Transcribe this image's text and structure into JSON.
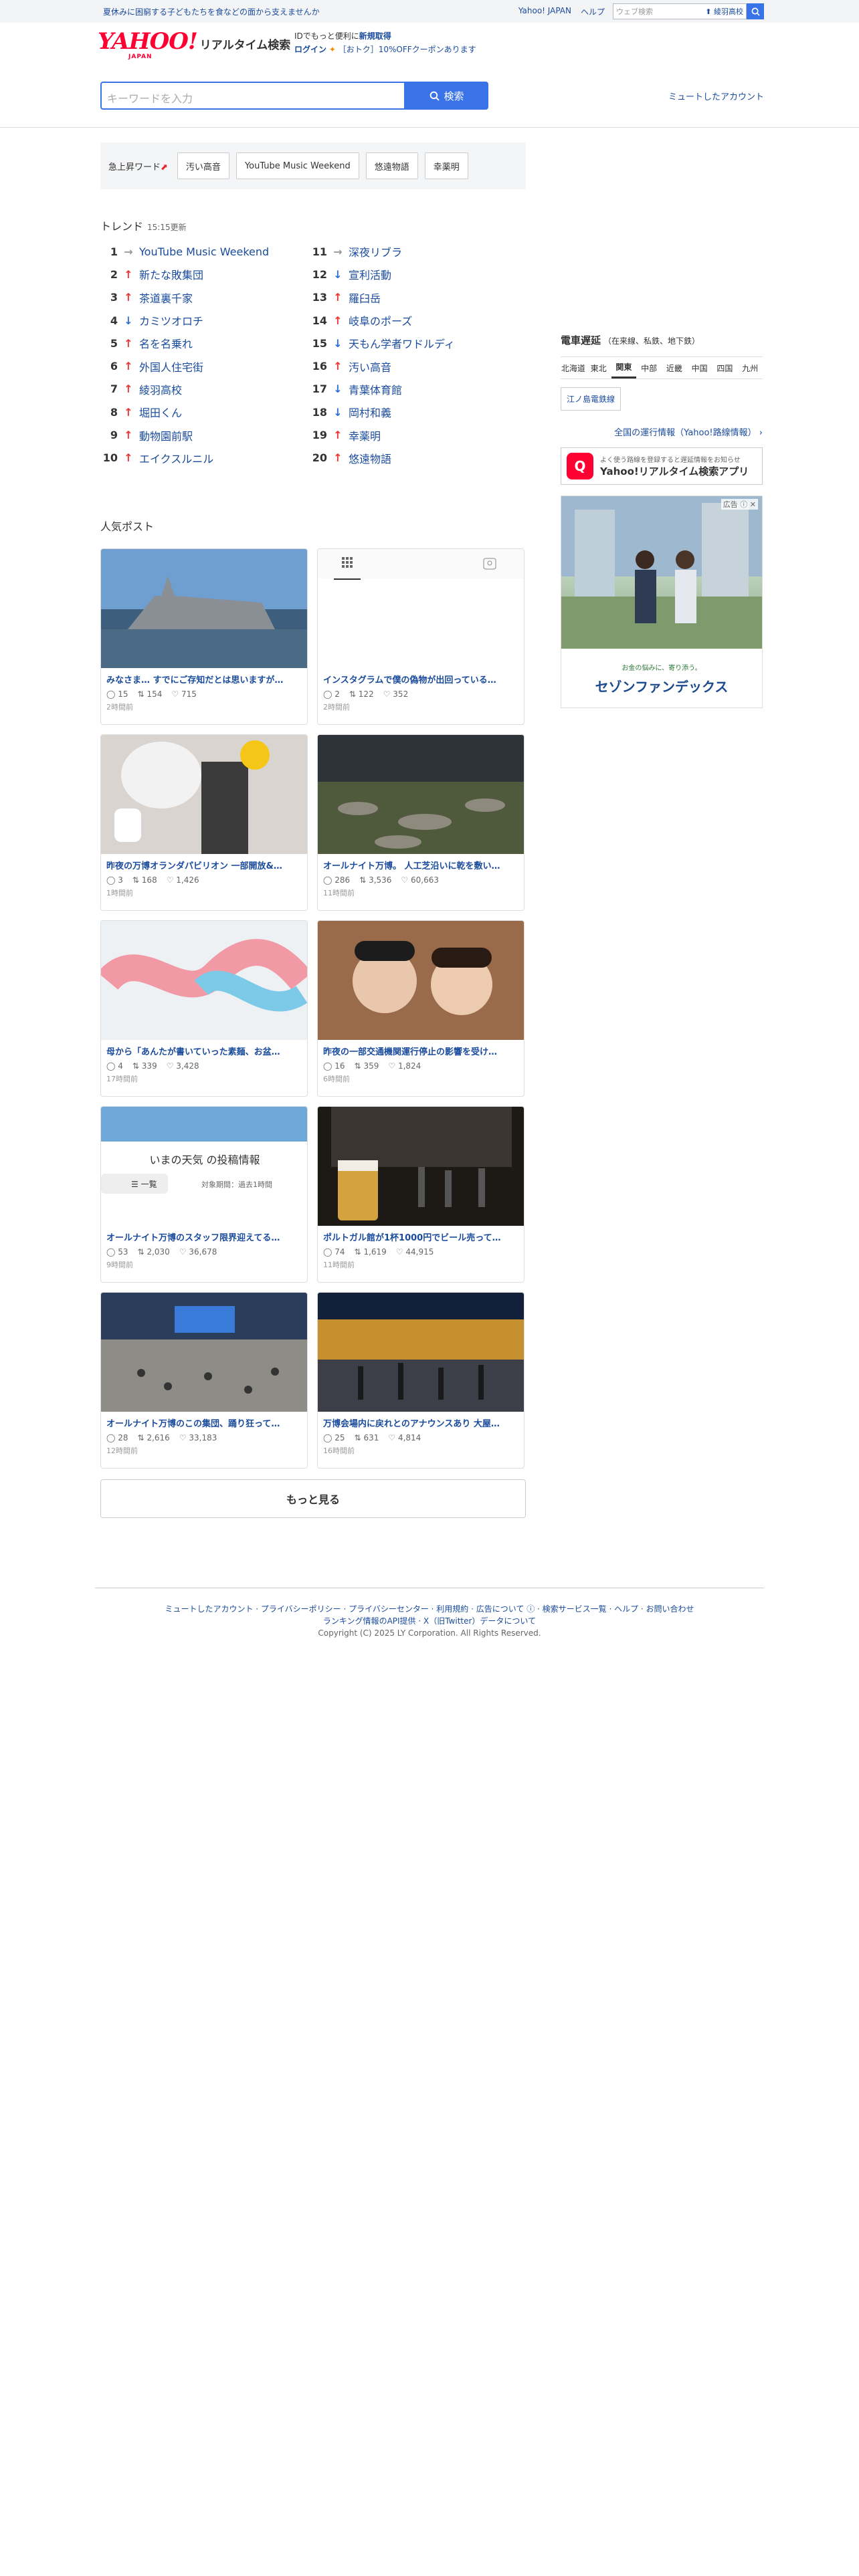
{
  "topbar": {
    "promo": "夏休みに困窮する子どもたちを食などの面から支えませんか",
    "links": [
      "Yahoo! JAPAN",
      "ヘルプ"
    ],
    "mini_search_placeholder": "ウェブ検索",
    "mini_search_trend": "綾羽高校"
  },
  "header": {
    "logo": "YAHOO!",
    "logo_sub": "JAPAN",
    "service_name": "リアルタイム検索",
    "login_line1_pre": "IDでもっと便利に",
    "login_line1_link": "新規取得",
    "login_link": "ログイン",
    "coupon": "［おトク］10%OFFクーポンあります"
  },
  "search": {
    "placeholder": "キーワードを入力",
    "button": "検索",
    "mute_link": "ミュートしたアカウント"
  },
  "surge": {
    "title": "急上昇ワード",
    "chips": [
      "汚い高音",
      "YouTube Music Weekend",
      "悠遠物語",
      "幸薬明"
    ]
  },
  "trends": {
    "title": "トレンド",
    "updated": "15:15更新",
    "items": [
      {
        "rank": "1",
        "dir": "flat",
        "word": "YouTube Music Weekend"
      },
      {
        "rank": "2",
        "dir": "up",
        "word": "新たな敗集団"
      },
      {
        "rank": "3",
        "dir": "up",
        "word": "茶道裏千家"
      },
      {
        "rank": "4",
        "dir": "down",
        "word": "カミツオロチ"
      },
      {
        "rank": "5",
        "dir": "up",
        "word": "名を名乗れ"
      },
      {
        "rank": "6",
        "dir": "up",
        "word": "外国人住宅街"
      },
      {
        "rank": "7",
        "dir": "up",
        "word": "綾羽高校"
      },
      {
        "rank": "8",
        "dir": "up",
        "word": "堀田くん"
      },
      {
        "rank": "9",
        "dir": "up",
        "word": "動物園前駅"
      },
      {
        "rank": "10",
        "dir": "up",
        "word": "エイクスルニル"
      },
      {
        "rank": "11",
        "dir": "flat",
        "word": "深夜リブラ"
      },
      {
        "rank": "12",
        "dir": "down",
        "word": "宣利活動"
      },
      {
        "rank": "13",
        "dir": "up",
        "word": "羅臼岳"
      },
      {
        "rank": "14",
        "dir": "up",
        "word": "岐阜のポーズ"
      },
      {
        "rank": "15",
        "dir": "down",
        "word": "天もん学者ワドルディ"
      },
      {
        "rank": "16",
        "dir": "up",
        "word": "汚い高音"
      },
      {
        "rank": "17",
        "dir": "down",
        "word": "青葉体育館"
      },
      {
        "rank": "18",
        "dir": "down",
        "word": "岡村和義"
      },
      {
        "rank": "19",
        "dir": "up",
        "word": "幸薬明"
      },
      {
        "rank": "20",
        "dir": "up",
        "word": "悠遠物語"
      }
    ]
  },
  "popular": {
    "title": "人気ポスト",
    "posts": [
      {
        "title": "みなさま… すでにご存知だとは思いますが…",
        "replies": "15",
        "reposts": "154",
        "likes": "715",
        "time": "2時間前"
      },
      {
        "title": "インスタグラムで僕の偽物が出回っている…",
        "replies": "2",
        "reposts": "122",
        "likes": "352",
        "time": "2時間前"
      },
      {
        "title": "昨夜の万博オランダパビリオン 一部開放&…",
        "replies": "3",
        "reposts": "168",
        "likes": "1,426",
        "time": "1時間前"
      },
      {
        "title": "オールナイト万博。 人工芝沿いに乾を敷い…",
        "replies": "286",
        "reposts": "3,536",
        "likes": "60,663",
        "time": "11時間前"
      },
      {
        "title": "母から「あんたが書いていった素麺、お盆…",
        "replies": "4",
        "reposts": "339",
        "likes": "3,428",
        "time": "17時間前"
      },
      {
        "title": "昨夜の一部交通機関運行停止の影響を受け…",
        "replies": "16",
        "reposts": "359",
        "likes": "1,824",
        "time": "6時間前"
      },
      {
        "title": "オールナイト万博のスタッフ限界迎えてる…",
        "replies": "53",
        "reposts": "2,030",
        "likes": "36,678",
        "time": "9時間前"
      },
      {
        "title": "ポルトガル館が1杯1000円でビール売って…",
        "replies": "74",
        "reposts": "1,619",
        "likes": "44,915",
        "time": "11時間前"
      },
      {
        "title": "オールナイト万博のこの集団、踊り狂って…",
        "replies": "28",
        "reposts": "2,616",
        "likes": "33,183",
        "time": "12時間前"
      },
      {
        "title": "万博会場内に戻れとのアナウンスあり 大屋…",
        "replies": "25",
        "reposts": "631",
        "likes": "4,814",
        "time": "16時間前"
      }
    ],
    "more": "もっと見る",
    "weather_text": "いまの天気 の投稿情報",
    "weather_sub": "対象期間：過去1時間",
    "weather_tab": "一覧"
  },
  "rail": {
    "train_title": "電車遅延",
    "train_sub": "（在来線、私鉄、地下鉄）",
    "regions": [
      "北海道",
      "東北",
      "関東",
      "中部",
      "近畿",
      "中国",
      "四国",
      "九州"
    ],
    "active_region": "関東",
    "line": "江ノ島電鉄線",
    "nat_link": "全国の運行情報（Yahoo!路線情報）",
    "app_small": "よく使う路線を登録すると遅延情報をお知らせ",
    "app_name": "Yahoo!リアルタイム検索アプリ",
    "ad_label": "広告",
    "ad_tagline": "お金の悩みに、寄り添う。",
    "ad_brand": "セゾンファンデックス"
  },
  "footer": {
    "links": "ミュートしたアカウント · プライバシーポリシー · プライバシーセンター · 利用規約 · 広告について ⓘ · 検索サービス一覧 · ヘルプ · お問い合わせ",
    "links2": "ランキング情報のAPI提供 · X（旧Twitter）データについて",
    "copyright": "Copyright (C) 2025 LY Corporation. All Rights Reserved."
  }
}
